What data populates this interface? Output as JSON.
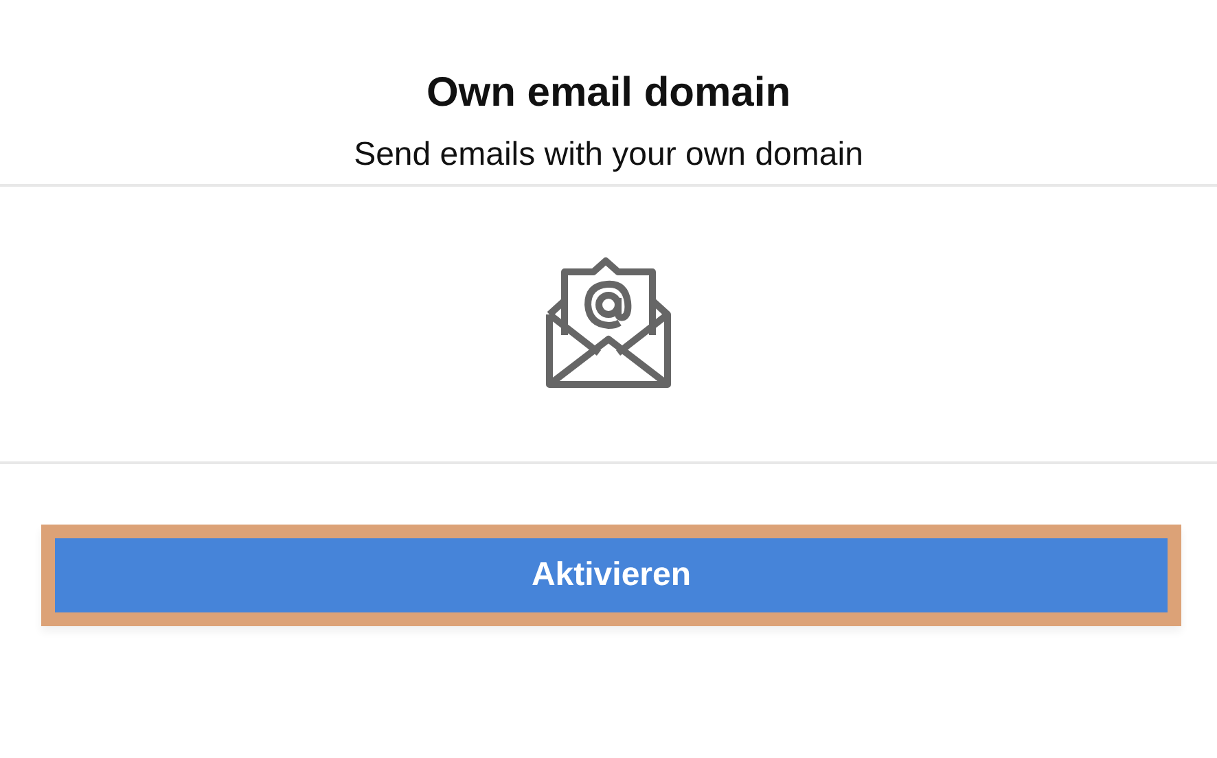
{
  "header": {
    "title": "Own email domain",
    "subtitle": "Send emails with your own domain"
  },
  "button": {
    "label": "Aktivieren",
    "focused": true
  }
}
